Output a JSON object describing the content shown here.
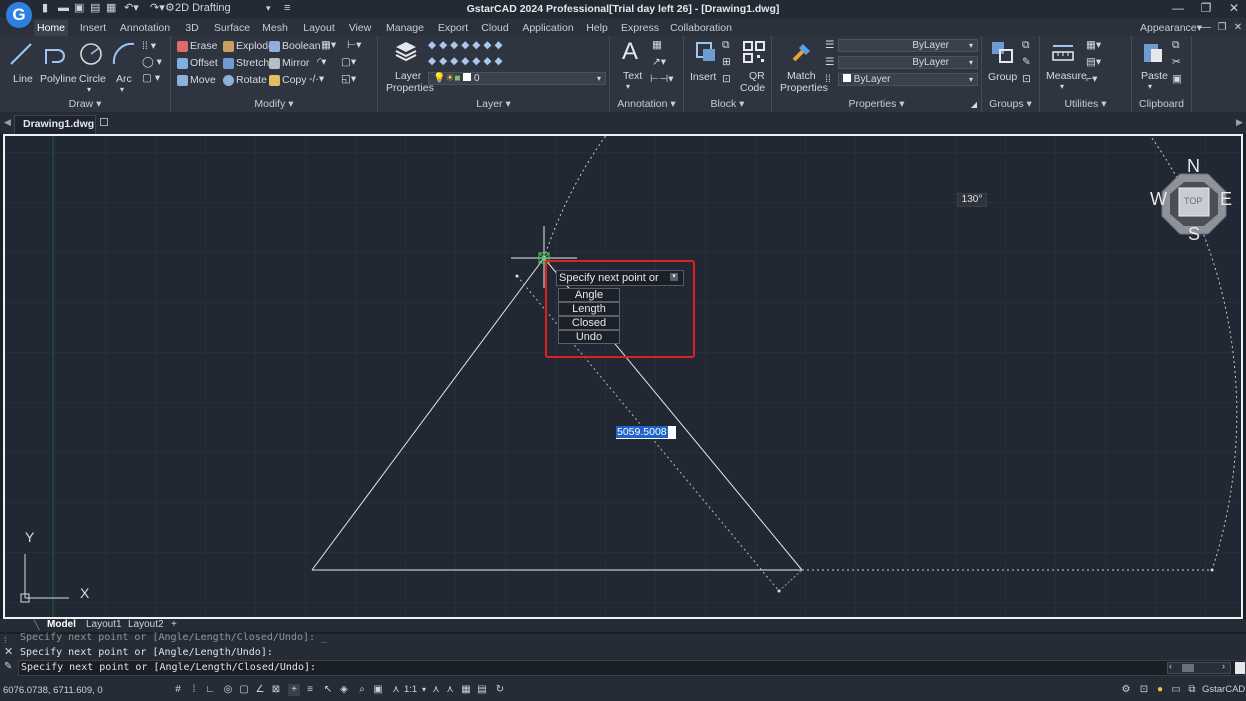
{
  "app": {
    "logo_letter": "G",
    "title": "GstarCAD 2024 Professional[Trial day left 26] - [Drawing1.dwg]",
    "workspace": "2D Drafting",
    "appearance": "Appearance"
  },
  "menu": {
    "tabs": [
      "Home",
      "Insert",
      "Annotation",
      "3D",
      "Surface",
      "Mesh",
      "Layout",
      "View",
      "Manage",
      "Export",
      "Cloud",
      "Application",
      "Help",
      "Express",
      "Collaboration"
    ],
    "active": "Home"
  },
  "ribbon": {
    "draw": {
      "title": "Draw",
      "line": "Line",
      "polyline": "Polyline",
      "circle": "Circle",
      "arc": "Arc"
    },
    "modify": {
      "title": "Modify",
      "erase": "Erase",
      "explode": "Explode",
      "boolean": "Boolean",
      "offset": "Offset",
      "stretch": "Stretch",
      "mirror": "Mirror",
      "move": "Move",
      "rotate": "Rotate",
      "copy": "Copy"
    },
    "layer": {
      "title": "Layer",
      "layer_properties_1": "Layer",
      "layer_properties_2": "Properties",
      "current_layer": "0"
    },
    "annotation": {
      "title": "Annotation",
      "text": "Text"
    },
    "block": {
      "title": "Block",
      "insert": "Insert",
      "qr_1": "QR",
      "qr_2": "Code"
    },
    "properties": {
      "title": "Properties",
      "match_1": "Match",
      "match_2": "Properties",
      "color": "ByLayer",
      "linetype": "ByLayer",
      "lineweight": "ByLayer"
    },
    "groups": {
      "title": "Groups",
      "group": "Group"
    },
    "utilities": {
      "title": "Utilities",
      "measure": "Measure"
    },
    "clipboard": {
      "title": "Clipboard",
      "paste": "Paste"
    }
  },
  "doc_tab": "Drawing1.dwg",
  "canvas": {
    "angle_label": "130°",
    "prompt": "Specify next point or",
    "options": [
      "Angle",
      "Length",
      "Closed",
      "Undo"
    ],
    "dynamic_input": "5059.5008",
    "ucs_x": "X",
    "ucs_y": "Y",
    "viewcube": {
      "n": "N",
      "s": "S",
      "e": "E",
      "w": "W",
      "face": "TOP"
    }
  },
  "layout_tabs": [
    "Model",
    "Layout1",
    "Layout2",
    "+"
  ],
  "command": {
    "line1": "Specify next point or [Angle/Length/Closed/Undo]: _",
    "line2": "Specify next point or [Angle/Length/Undo]:",
    "line3": "Specify next point or [Angle/Length/Closed/Undo]:"
  },
  "status": {
    "coords": "6076.0738, 6711.609, 0",
    "scale": "1:1",
    "app_name": "GstarCAD"
  },
  "colors": {
    "highlight": "#e02020",
    "selection": "#1e63c8",
    "canvas_bg": "#212833"
  }
}
